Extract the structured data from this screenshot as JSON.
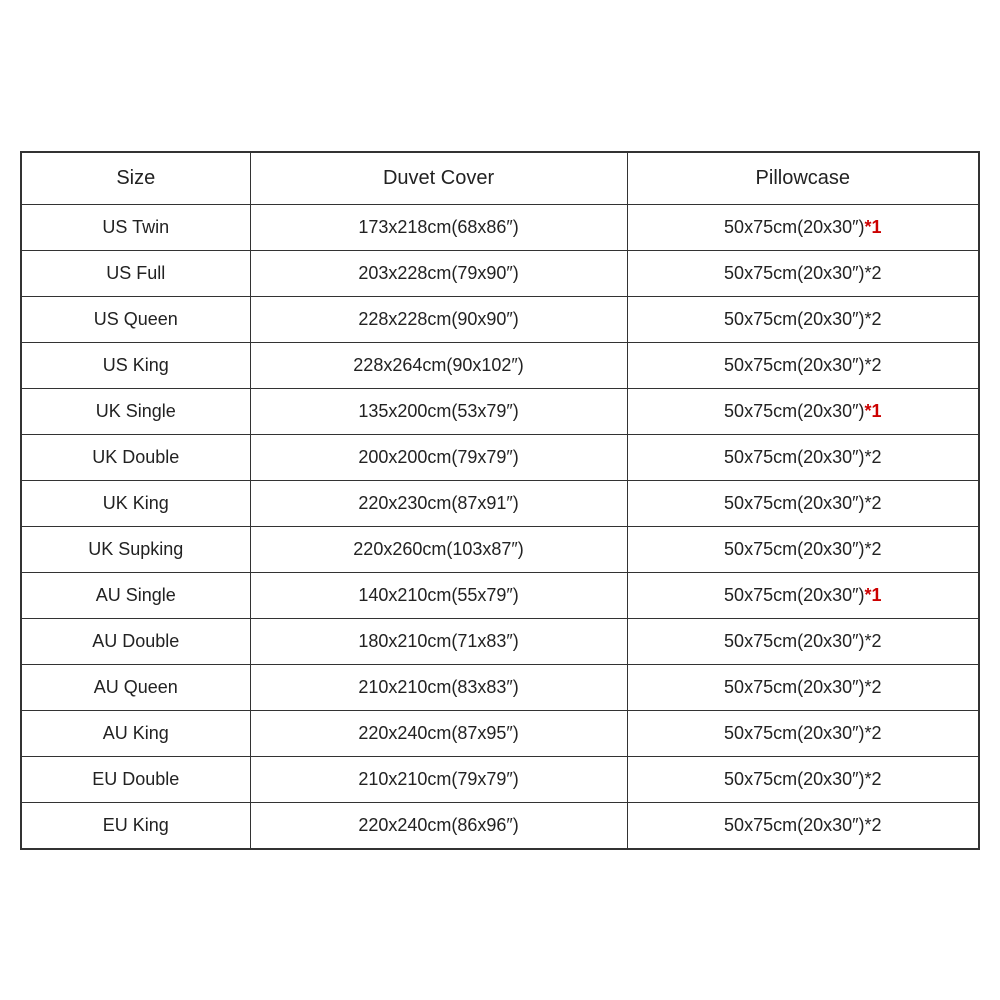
{
  "table": {
    "headers": [
      "Size",
      "Duvet Cover",
      "Pillowcase"
    ],
    "rows": [
      {
        "size": "US Twin",
        "duvet": "173x218cm(68x86″)",
        "pillowcase": "50x75cm(20x30″)*1",
        "pillowcase_highlight": "*1"
      },
      {
        "size": "US Full",
        "duvet": "203x228cm(79x90″)",
        "pillowcase": "50x75cm(20x30″)*2",
        "pillowcase_highlight": null
      },
      {
        "size": "US Queen",
        "duvet": "228x228cm(90x90″)",
        "pillowcase": "50x75cm(20x30″)*2",
        "pillowcase_highlight": null
      },
      {
        "size": "US King",
        "duvet": "228x264cm(90x102″)",
        "pillowcase": "50x75cm(20x30″)*2",
        "pillowcase_highlight": null
      },
      {
        "size": "UK Single",
        "duvet": "135x200cm(53x79″)",
        "pillowcase": "50x75cm(20x30″)*1",
        "pillowcase_highlight": "*1"
      },
      {
        "size": "UK Double",
        "duvet": "200x200cm(79x79″)",
        "pillowcase": "50x75cm(20x30″)*2",
        "pillowcase_highlight": null
      },
      {
        "size": "UK King",
        "duvet": "220x230cm(87x91″)",
        "pillowcase": "50x75cm(20x30″)*2",
        "pillowcase_highlight": null
      },
      {
        "size": "UK Supking",
        "duvet": "220x260cm(103x87″)",
        "pillowcase": "50x75cm(20x30″)*2",
        "pillowcase_highlight": null
      },
      {
        "size": "AU Single",
        "duvet": "140x210cm(55x79″)",
        "pillowcase": "50x75cm(20x30″)*1",
        "pillowcase_highlight": "*1"
      },
      {
        "size": "AU Double",
        "duvet": "180x210cm(71x83″)",
        "pillowcase": "50x75cm(20x30″)*2",
        "pillowcase_highlight": null
      },
      {
        "size": "AU Queen",
        "duvet": "210x210cm(83x83″)",
        "pillowcase": "50x75cm(20x30″)*2",
        "pillowcase_highlight": null
      },
      {
        "size": "AU King",
        "duvet": "220x240cm(87x95″)",
        "pillowcase": "50x75cm(20x30″)*2",
        "pillowcase_highlight": null
      },
      {
        "size": "EU Double",
        "duvet": "210x210cm(79x79″)",
        "pillowcase": "50x75cm(20x30″)*2",
        "pillowcase_highlight": null
      },
      {
        "size": "EU King",
        "duvet": "220x240cm(86x96″)",
        "pillowcase": "50x75cm(20x30″)*2",
        "pillowcase_highlight": null
      }
    ]
  }
}
